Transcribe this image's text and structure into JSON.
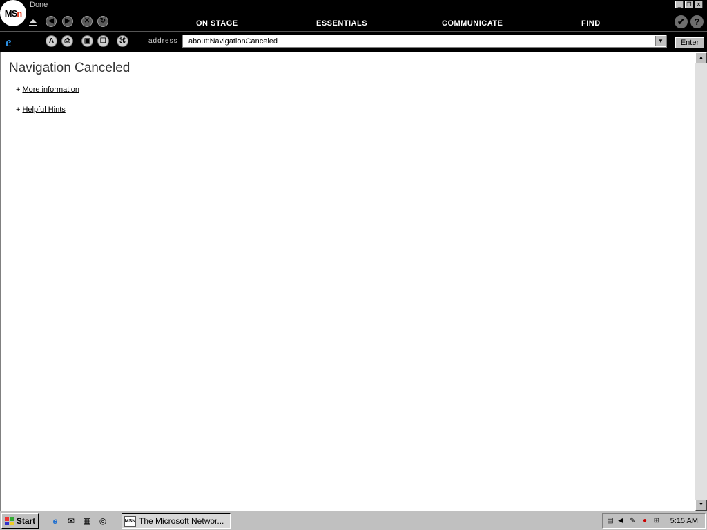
{
  "window": {
    "status": "Done",
    "logo": "MSN",
    "menu": [
      "ON STAGE",
      "ESSENTIALS",
      "COMMUNICATE",
      "FIND"
    ],
    "address_label": "address",
    "address_value": "about:NavigationCanceled",
    "enter_label": "Enter"
  },
  "page": {
    "title": "Navigation Canceled",
    "links": [
      {
        "prefix": "+",
        "label": "More information"
      },
      {
        "prefix": "+",
        "label": "Helpful Hints"
      }
    ]
  },
  "taskbar": {
    "start_label": "Start",
    "task_label": "The Microsoft Networ...",
    "clock": "5:15 AM"
  }
}
